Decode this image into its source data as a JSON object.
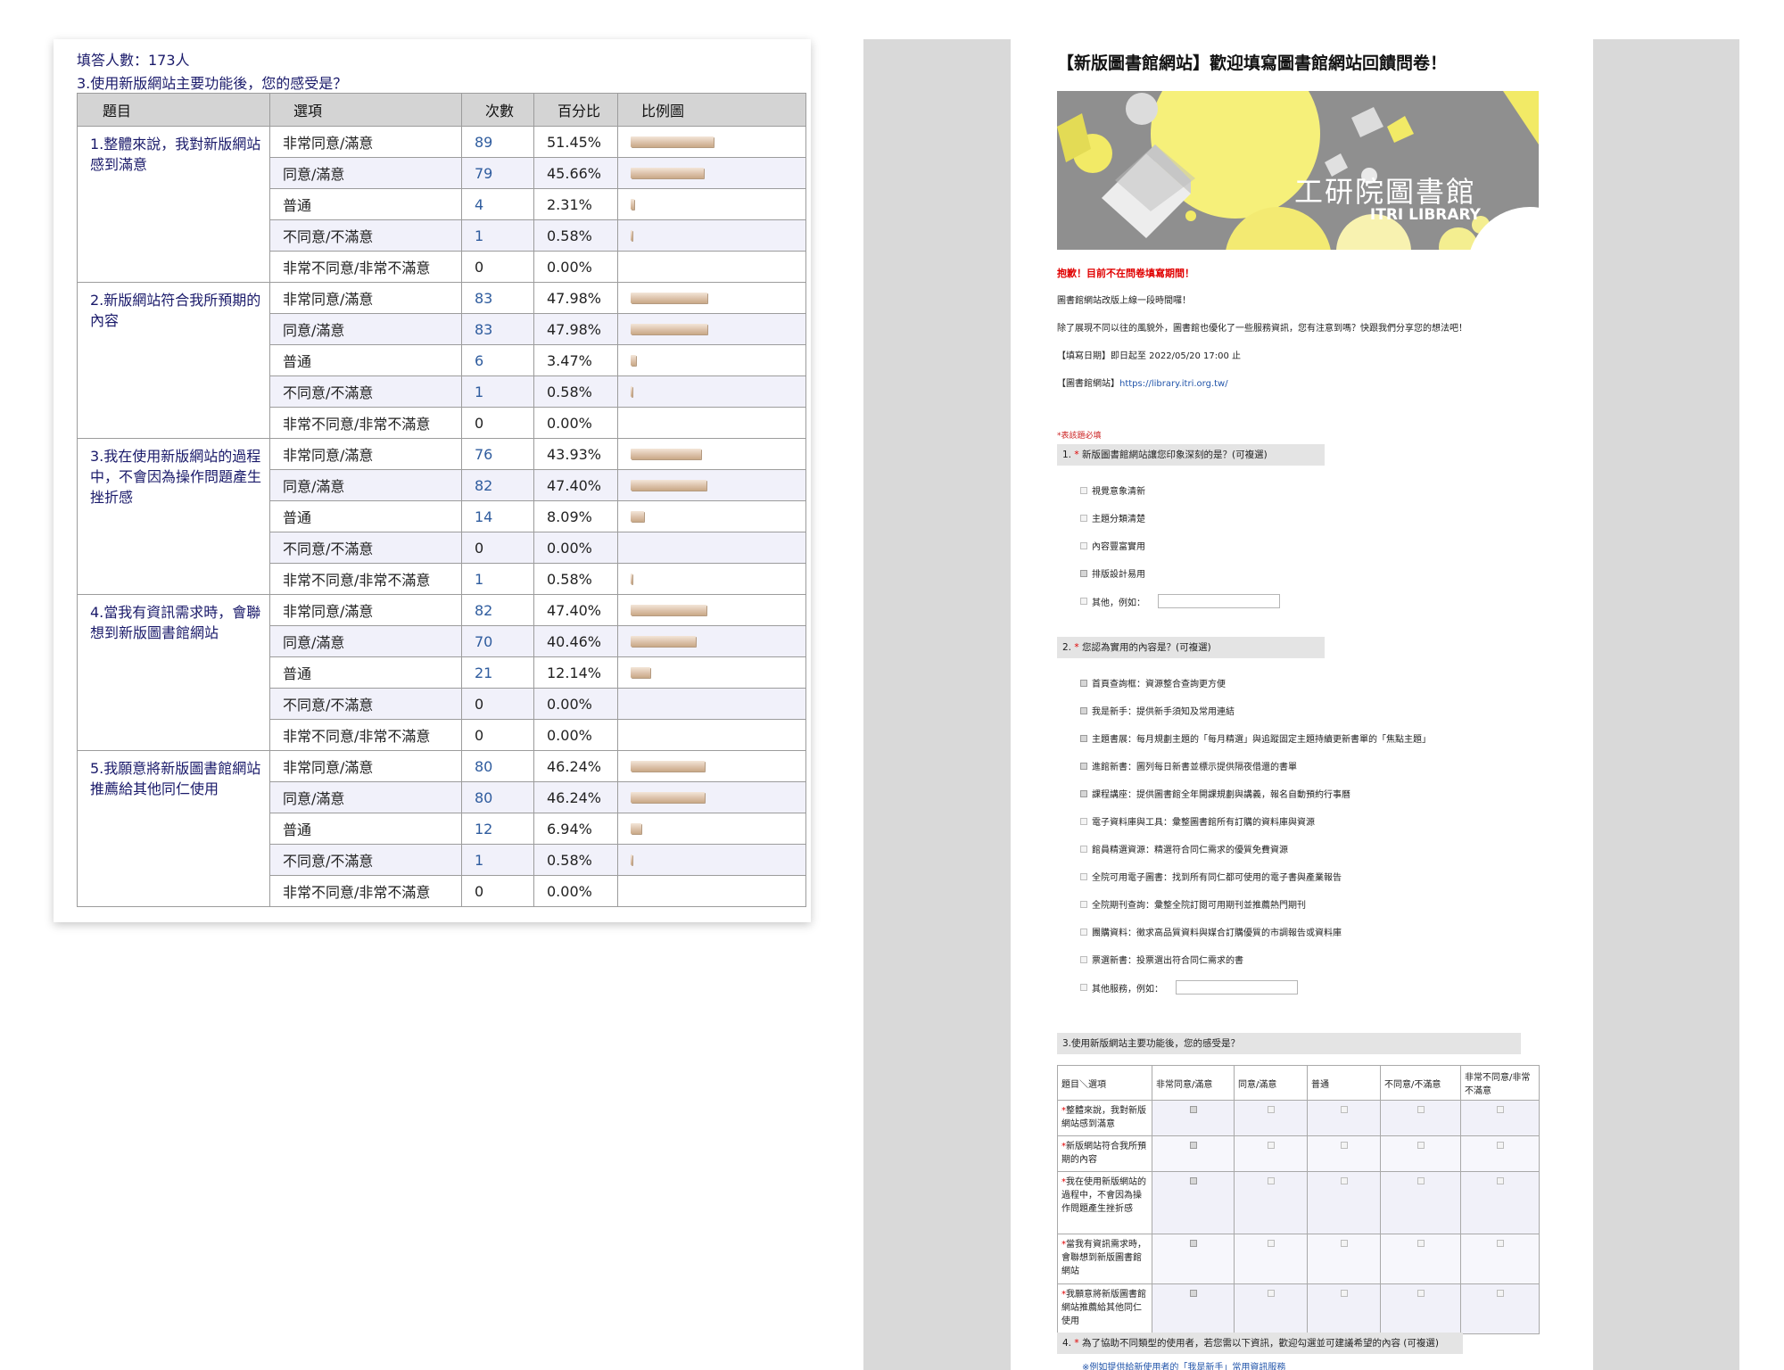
{
  "results": {
    "respondents_label": "填答人數：173人",
    "question_title": "3.使用新版網站主要功能後，您的感受是？",
    "headers": [
      "題目",
      "選項",
      "次數",
      "百分比",
      "比例圖"
    ],
    "groups": [
      {
        "question": "1.整體來說，我對新版網站感到滿意",
        "rows": [
          {
            "option": "非常同意/滿意",
            "count": "89",
            "pct": "51.45%",
            "ratio": 51.45
          },
          {
            "option": "同意/滿意",
            "count": "79",
            "pct": "45.66%",
            "ratio": 45.66
          },
          {
            "option": "普通",
            "count": "4",
            "pct": "2.31%",
            "ratio": 2.31
          },
          {
            "option": "不同意/不滿意",
            "count": "1",
            "pct": "0.58%",
            "ratio": 0.58
          },
          {
            "option": "非常不同意/非常不滿意",
            "count": "0",
            "pct": "0.00%",
            "ratio": 0
          }
        ]
      },
      {
        "question": "2.新版網站符合我所預期的內容",
        "rows": [
          {
            "option": "非常同意/滿意",
            "count": "83",
            "pct": "47.98%",
            "ratio": 47.98
          },
          {
            "option": "同意/滿意",
            "count": "83",
            "pct": "47.98%",
            "ratio": 47.98
          },
          {
            "option": "普通",
            "count": "6",
            "pct": "3.47%",
            "ratio": 3.47
          },
          {
            "option": "不同意/不滿意",
            "count": "1",
            "pct": "0.58%",
            "ratio": 0.58
          },
          {
            "option": "非常不同意/非常不滿意",
            "count": "0",
            "pct": "0.00%",
            "ratio": 0
          }
        ]
      },
      {
        "question": "3.我在使用新版網站的過程中，不會因為操作問題產生挫折感",
        "rows": [
          {
            "option": "非常同意/滿意",
            "count": "76",
            "pct": "43.93%",
            "ratio": 43.93
          },
          {
            "option": "同意/滿意",
            "count": "82",
            "pct": "47.40%",
            "ratio": 47.4
          },
          {
            "option": "普通",
            "count": "14",
            "pct": "8.09%",
            "ratio": 8.09
          },
          {
            "option": "不同意/不滿意",
            "count": "0",
            "pct": "0.00%",
            "ratio": 0
          },
          {
            "option": "非常不同意/非常不滿意",
            "count": "1",
            "pct": "0.58%",
            "ratio": 0.58
          }
        ]
      },
      {
        "question": "4.當我有資訊需求時，會聯想到新版圖書館網站",
        "rows": [
          {
            "option": "非常同意/滿意",
            "count": "82",
            "pct": "47.40%",
            "ratio": 47.4
          },
          {
            "option": "同意/滿意",
            "count": "70",
            "pct": "40.46%",
            "ratio": 40.46
          },
          {
            "option": "普通",
            "count": "21",
            "pct": "12.14%",
            "ratio": 12.14
          },
          {
            "option": "不同意/不滿意",
            "count": "0",
            "pct": "0.00%",
            "ratio": 0
          },
          {
            "option": "非常不同意/非常不滿意",
            "count": "0",
            "pct": "0.00%",
            "ratio": 0
          }
        ]
      },
      {
        "question": "5.我願意將新版圖書館網站推薦給其他同仁使用",
        "rows": [
          {
            "option": "非常同意/滿意",
            "count": "80",
            "pct": "46.24%",
            "ratio": 46.24
          },
          {
            "option": "同意/滿意",
            "count": "80",
            "pct": "46.24%",
            "ratio": 46.24
          },
          {
            "option": "普通",
            "count": "12",
            "pct": "6.94%",
            "ratio": 6.94
          },
          {
            "option": "不同意/不滿意",
            "count": "1",
            "pct": "0.58%",
            "ratio": 0.58
          },
          {
            "option": "非常不同意/非常不滿意",
            "count": "0",
            "pct": "0.00%",
            "ratio": 0
          }
        ]
      }
    ]
  },
  "form": {
    "title": "【新版圖書館網站】歡迎填寫圖書館網站回饋問卷！",
    "banner": {
      "title_cn": "工研院圖書館",
      "title_en": "ITRI LIBRARY"
    },
    "closed_notice": "抱歉！目前不在問卷填寫期間！",
    "intro_1": "圖書館網站改版上線一段時間囉！",
    "intro_2": "除了展現不同以往的風貌外，圖書館也優化了一些服務資訊，您有注意到嗎？快跟我們分享您的想法吧！",
    "date_label": "【填寫日期】即日起至 2022/05/20 17:00 止",
    "site_label": "【圖書館網站】",
    "site_url": "https://library.itri.org.tw/",
    "required_note": "*表該題必填",
    "q1": {
      "number": "1.",
      "star": "*",
      "title": "新版圖書館網站讓您印象深刻的是？(可複選)",
      "options": [
        {
          "label": "視覺意象清新",
          "checked": false
        },
        {
          "label": "主題分類清楚",
          "checked": false
        },
        {
          "label": "內容豐富實用",
          "checked": false
        },
        {
          "label": "排版設計易用",
          "checked": true
        },
        {
          "label": "其他，例如：",
          "checked": false
        }
      ]
    },
    "q2": {
      "number": "2.",
      "star": "*",
      "title": "您認為實用的內容是？(可複選)",
      "options": [
        {
          "label": "首頁查詢框：資源整合查詢更方便",
          "checked": true
        },
        {
          "label": "我是新手：提供新手須知及常用連結",
          "checked": true
        },
        {
          "label": "主題書展：每月規劃主題的「每月精選」與追蹤固定主題持續更新書單的「焦點主題」",
          "checked": true
        },
        {
          "label": "進館新書：圖列每日新書並標示提供隔夜借還的書單",
          "checked": true
        },
        {
          "label": "課程講座：提供圖書館全年開課規劃與講義，報名自動預約行事曆",
          "checked": true
        },
        {
          "label": "電子資料庫與工具：彙整圖書館所有訂購的資料庫與資源",
          "checked": false
        },
        {
          "label": "館員精選資源：精選符合同仁需求的優質免費資源",
          "checked": false
        },
        {
          "label": "全院可用電子圖書：找到所有同仁都可使用的電子書與產業報告",
          "checked": false
        },
        {
          "label": "全院期刊查詢：彙整全院訂閱可用期刊並推薦熱門期刊",
          "checked": false
        },
        {
          "label": "團購資料：徵求高品質資料與媒合訂購優質的市調報告或資料庫",
          "checked": false
        },
        {
          "label": "票選新書：投票選出符合同仁需求的書",
          "checked": false
        },
        {
          "label": "其他服務，例如：",
          "checked": false
        }
      ]
    },
    "q3": {
      "title": "3.使用新版網站主要功能後，您的感受是？",
      "corner_label": "題目＼選項",
      "columns": [
        "非常同意/滿意",
        "同意/滿意",
        "普通",
        "不同意/不滿意",
        "非常不同意/非常不滿意"
      ],
      "rows": [
        {
          "star": "*",
          "label": "整體來說，我對新版網站感到滿意"
        },
        {
          "star": "*",
          "label": "新版網站符合我所預期的內容"
        },
        {
          "star": "*",
          "label": "我在使用新版網站的過程中，不會因為操作問題產生挫折感"
        },
        {
          "star": "*",
          "label": "當我有資訊需求時，會聯想到新版圖書館網站"
        },
        {
          "star": "*",
          "label": "我願意將新版圖書館網站推薦給其他同仁使用"
        }
      ]
    },
    "q4": {
      "number": "4.",
      "star": "*",
      "title": "為了協助不同類型的使用者，若您需以下資訊，歡迎勾選並可建議希望的內容 (可複選)",
      "note": "※例如提供給新使用者的「我是新手」常用資訊服務"
    }
  }
}
